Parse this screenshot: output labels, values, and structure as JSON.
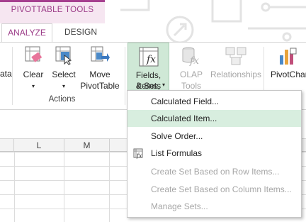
{
  "tabs": {
    "context_label": "PIVOTTABLE TOOLS",
    "analyze": "ANALYZE",
    "design": "DESIGN"
  },
  "ribbon": {
    "cut_label": "ata",
    "clear": "Clear",
    "select": "Select",
    "move_line1": "Move",
    "move_line2": "PivotTable",
    "group_actions": "Actions",
    "fields_line1": "Fields, Items,",
    "fields_line2": "& Sets",
    "olap_line1": "OLAP",
    "olap_line2": "Tools",
    "relationships": "Relationships",
    "pivotchart": "PivotChar"
  },
  "sheet": {
    "columns": [
      "L",
      "M"
    ]
  },
  "menu": {
    "items": [
      {
        "label": "Calculated Field...",
        "enabled": true,
        "highlighted": false
      },
      {
        "label": "Calculated Item...",
        "enabled": true,
        "highlighted": true
      },
      {
        "label": "Solve Order...",
        "enabled": true,
        "highlighted": false
      },
      {
        "label": "List Formulas",
        "enabled": true,
        "highlighted": false
      },
      {
        "label": "Create Set Based on Row Items...",
        "enabled": false,
        "highlighted": false
      },
      {
        "label": "Create Set Based on Column Items...",
        "enabled": false,
        "highlighted": false
      },
      {
        "label": "Manage Sets...",
        "enabled": false,
        "highlighted": false
      }
    ]
  },
  "colors": {
    "accent": "#a63f8f",
    "highlight": "#d8eedf",
    "disabled": "#a6a6a6"
  }
}
